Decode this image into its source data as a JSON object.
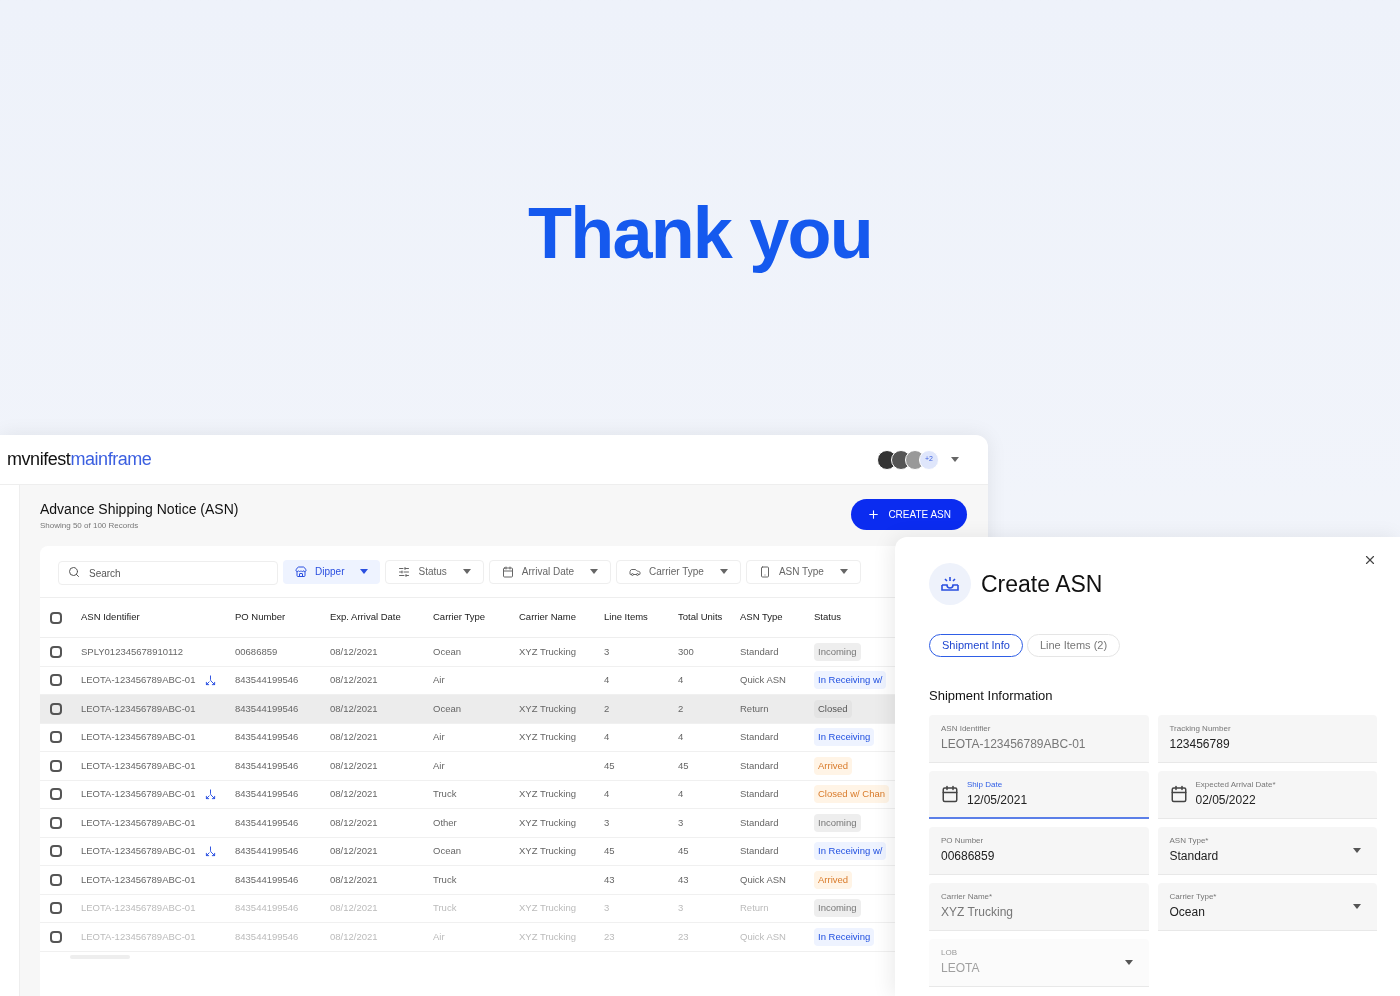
{
  "headline": "Thank you",
  "app": {
    "logo": {
      "dark": "mvnifest",
      "blue": "mainframe"
    },
    "avatars_more": "+2",
    "page_title": "Advance Shipping Notice (ASN)",
    "page_subtitle": "Showing 50 of 100 Records",
    "create_button": "CREATE ASN",
    "search": {
      "placeholder": "Search"
    },
    "filters": [
      {
        "label": "Dipper",
        "selected": true
      },
      {
        "label": "Status",
        "selected": false
      },
      {
        "label": "Arrival Date",
        "selected": false
      },
      {
        "label": "Carrier Type",
        "selected": false
      },
      {
        "label": "ASN Type",
        "selected": false
      }
    ],
    "table": {
      "all_checked": false,
      "columns": [
        "ASN Identifier",
        "PO Number",
        "Exp. Arrival Date",
        "Carrier Type",
        "Carrier Name",
        "Line Items",
        "Total Units",
        "ASN Type",
        "Status"
      ],
      "rows": [
        {
          "checked": false,
          "id": "SPLY012345678910112",
          "split": false,
          "po": "00686859",
          "date": "08/12/2021",
          "carrier_type": "Ocean",
          "carrier_name": "XYZ Trucking",
          "line_items": "3",
          "total_units": "300",
          "asn_type": "Standard",
          "status": "Incoming",
          "kind": "gray",
          "hovered": false
        },
        {
          "checked": false,
          "id": "LEOTA-123456789ABC-01",
          "split": true,
          "po": "843544199546",
          "date": "08/12/2021",
          "carrier_type": "Air",
          "carrier_name": "",
          "line_items": "4",
          "total_units": "4",
          "asn_type": "Quick ASN",
          "status": "In Receiving w/",
          "kind": "blue",
          "hovered": false
        },
        {
          "checked": false,
          "id": "LEOTA-123456789ABC-01",
          "split": false,
          "po": "843544199546",
          "date": "08/12/2021",
          "carrier_type": "Ocean",
          "carrier_name": "XYZ Trucking",
          "line_items": "2",
          "total_units": "2",
          "asn_type": "Return",
          "status": "Closed",
          "kind": "dark",
          "hovered": true
        },
        {
          "checked": false,
          "id": "LEOTA-123456789ABC-01",
          "split": false,
          "po": "843544199546",
          "date": "08/12/2021",
          "carrier_type": "Air",
          "carrier_name": "XYZ Trucking",
          "line_items": "4",
          "total_units": "4",
          "asn_type": "Standard",
          "status": "In Receiving",
          "kind": "blue",
          "hovered": false
        },
        {
          "checked": false,
          "id": "LEOTA-123456789ABC-01",
          "split": false,
          "po": "843544199546",
          "date": "08/12/2021",
          "carrier_type": "Air",
          "carrier_name": "",
          "line_items": "45",
          "total_units": "45",
          "asn_type": "Standard",
          "status": "Arrived",
          "kind": "orange",
          "hovered": false
        },
        {
          "checked": false,
          "id": "LEOTA-123456789ABC-01",
          "split": true,
          "po": "843544199546",
          "date": "08/12/2021",
          "carrier_type": "Truck",
          "carrier_name": "XYZ Trucking",
          "line_items": "4",
          "total_units": "4",
          "asn_type": "Standard",
          "status": "Closed w/ Chan",
          "kind": "orange",
          "hovered": false
        },
        {
          "checked": false,
          "id": "LEOTA-123456789ABC-01",
          "split": false,
          "po": "843544199546",
          "date": "08/12/2021",
          "carrier_type": "Other",
          "carrier_name": "XYZ Trucking",
          "line_items": "3",
          "total_units": "3",
          "asn_type": "Standard",
          "status": "Incoming",
          "kind": "gray",
          "hovered": false
        },
        {
          "checked": false,
          "id": "LEOTA-123456789ABC-01",
          "split": true,
          "po": "843544199546",
          "date": "08/12/2021",
          "carrier_type": "Ocean",
          "carrier_name": "XYZ Trucking",
          "line_items": "45",
          "total_units": "45",
          "asn_type": "Standard",
          "status": "In Receiving w/",
          "kind": "blue",
          "hovered": false
        },
        {
          "checked": false,
          "id": "LEOTA-123456789ABC-01",
          "split": false,
          "po": "843544199546",
          "date": "08/12/2021",
          "carrier_type": "Truck",
          "carrier_name": "",
          "line_items": "43",
          "total_units": "43",
          "asn_type": "Quick ASN",
          "status": "Arrived",
          "kind": "orange",
          "hovered": false
        },
        {
          "checked": false,
          "id": "LEOTA-123456789ABC-01",
          "split": false,
          "po": "843544199546",
          "date": "08/12/2021",
          "carrier_type": "Truck",
          "carrier_name": "XYZ Trucking",
          "line_items": "3",
          "total_units": "3",
          "asn_type": "Return",
          "status": "Incoming",
          "kind": "gray",
          "hovered": false
        },
        {
          "checked": false,
          "id": "LEOTA-123456789ABC-01",
          "split": false,
          "po": "843544199546",
          "date": "08/12/2021",
          "carrier_type": "Air",
          "carrier_name": "XYZ Trucking",
          "line_items": "23",
          "total_units": "23",
          "asn_type": "Quick ASN",
          "status": "In Receiving",
          "kind": "blue",
          "hovered": false
        }
      ]
    }
  },
  "panel": {
    "title": "Create ASN",
    "tabs": [
      {
        "label": "Shipment Info",
        "selected": true
      },
      {
        "label": "Line Items (2)",
        "selected": false
      }
    ],
    "section": "Shipment Information",
    "fields": [
      {
        "kind": "text",
        "label": "ASN Identifier",
        "value": "LEOTA-123456789ABC-01",
        "focused": false,
        "disabled": false,
        "muted": true
      },
      {
        "kind": "text",
        "label": "Tracking Number",
        "value": "123456789",
        "focused": false,
        "disabled": false,
        "muted": false
      },
      {
        "kind": "date",
        "label": "Ship Date",
        "value": "12/05/2021",
        "focused": true,
        "disabled": false,
        "muted": false
      },
      {
        "kind": "date",
        "label": "Expected Arrival Date*",
        "value": "02/05/2022",
        "focused": false,
        "disabled": false,
        "muted": false
      },
      {
        "kind": "text",
        "label": "PO Number",
        "value": "00686859",
        "focused": false,
        "disabled": false,
        "muted": false
      },
      {
        "kind": "select",
        "label": "ASN Type*",
        "value": "Standard",
        "focused": false,
        "disabled": false,
        "muted": false
      },
      {
        "kind": "text",
        "label": "Carrier Name*",
        "value": "XYZ Trucking",
        "focused": false,
        "disabled": false,
        "muted": true
      },
      {
        "kind": "select",
        "label": "Carrier Type*",
        "value": "Ocean",
        "focused": false,
        "disabled": false,
        "muted": false
      },
      {
        "kind": "select",
        "label": "LOB",
        "value": "LEOTA",
        "focused": false,
        "disabled": true,
        "muted": true
      }
    ]
  }
}
